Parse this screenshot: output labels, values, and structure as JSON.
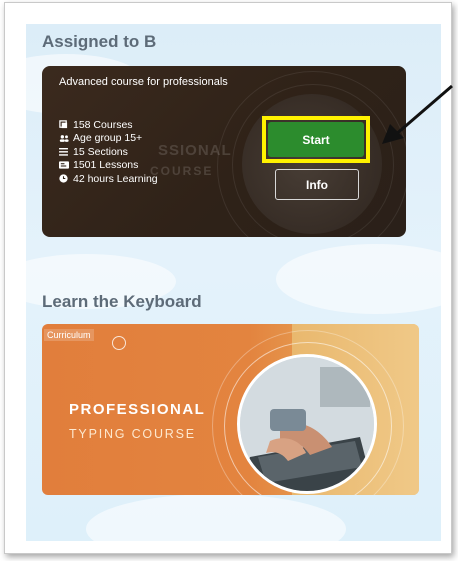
{
  "sections": {
    "assigned_heading": "Assigned to B",
    "keyboard_heading": "Learn the Keyboard"
  },
  "course_card": {
    "subtitle": "Advanced course for professionals",
    "bg_text_1": "SSIONAL",
    "bg_text_2": "COURSE",
    "stats": [
      {
        "icon": "courses-icon",
        "label": "158 Courses"
      },
      {
        "icon": "age-group-icon",
        "label": "Age group 15+"
      },
      {
        "icon": "sections-icon",
        "label": "15 Sections"
      },
      {
        "icon": "lessons-icon",
        "label": "1501 Lessons"
      },
      {
        "icon": "clock-icon",
        "label": "42 hours Learning"
      }
    ],
    "start_label": "Start",
    "info_label": "Info"
  },
  "keyboard_card": {
    "tag": "Curriculum",
    "title_line1": "PROFESSIONAL",
    "title_line2": "TYPING COURSE"
  },
  "colors": {
    "start_button": "#2c8c2d",
    "highlight": "#fff200",
    "card_dark": "#2f2218",
    "card_orange": "#e17e3c"
  }
}
